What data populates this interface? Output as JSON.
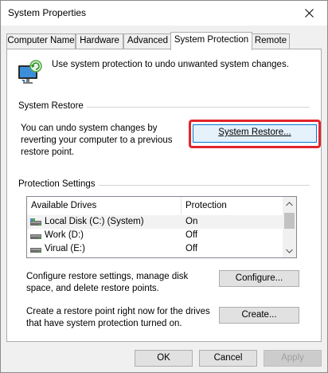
{
  "window": {
    "title": "System Properties"
  },
  "tabs": [
    {
      "label": "Computer Name"
    },
    {
      "label": "Hardware"
    },
    {
      "label": "Advanced"
    },
    {
      "label": "System Protection"
    },
    {
      "label": "Remote"
    }
  ],
  "intro": {
    "text": "Use system protection to undo unwanted system changes."
  },
  "system_restore": {
    "group_label": "System Restore",
    "text": "You can undo system changes by reverting your computer to a previous restore point.",
    "button_label": "System Restore..."
  },
  "protection": {
    "group_label": "Protection Settings",
    "columns": [
      "Available Drives",
      "Protection"
    ],
    "drives": [
      {
        "name": "Local Disk (C:) (System)",
        "protection": "On",
        "icon": "system-drive-icon"
      },
      {
        "name": "Work (D:)",
        "protection": "Off",
        "icon": "drive-icon"
      },
      {
        "name": "Virual (E:)",
        "protection": "Off",
        "icon": "drive-icon"
      }
    ]
  },
  "configure": {
    "text": "Configure restore settings, manage disk space, and delete restore points.",
    "button_label": "Configure..."
  },
  "create": {
    "text": "Create a restore point right now for the drives that have system protection turned on.",
    "button_label": "Create..."
  },
  "footer": {
    "ok_label": "OK",
    "cancel_label": "Cancel",
    "apply_label": "Apply"
  },
  "colors": {
    "highlight": "#e3242b",
    "accent": "#0078d7"
  }
}
